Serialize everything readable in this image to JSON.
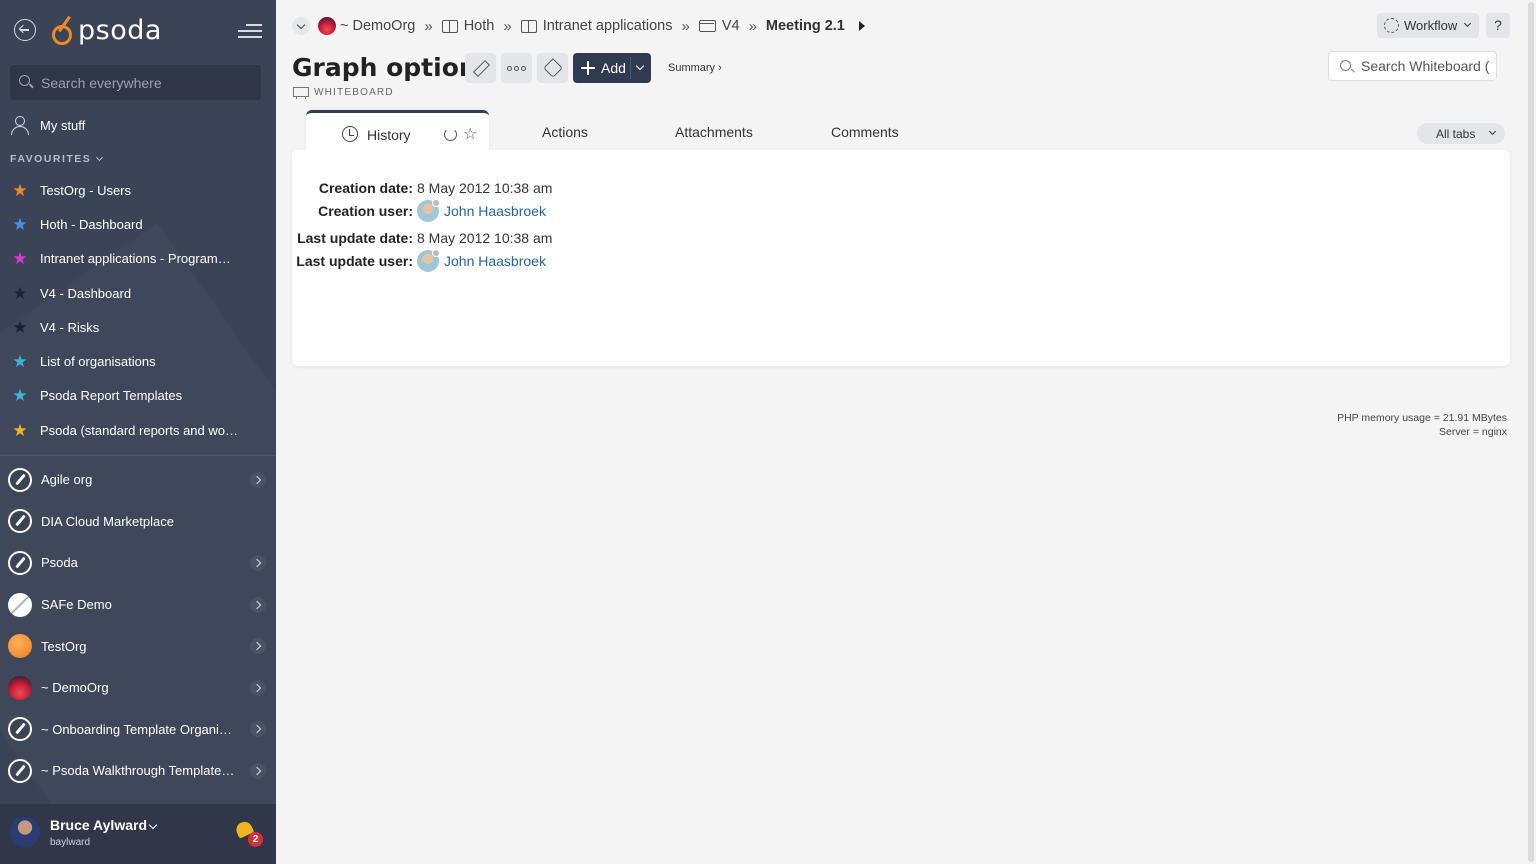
{
  "sidebar": {
    "logo_text": "psoda",
    "search_placeholder": "Search everywhere",
    "my_stuff": "My stuff",
    "favourites_heading": "FAVOURITES",
    "favourites": [
      {
        "label": "TestOrg - Users",
        "star_color": "#f08a24"
      },
      {
        "label": "Hoth - Dashboard",
        "star_color": "#4a90e2"
      },
      {
        "label": "Intranet applications - Programme...",
        "star_color": "#d43bd1"
      },
      {
        "label": "V4 - Dashboard",
        "star_color": "#1c2333"
      },
      {
        "label": "V4 - Risks",
        "star_color": "#1c2333"
      },
      {
        "label": "List of organisations",
        "star_color": "#3bb5d8"
      },
      {
        "label": "Psoda Report Templates",
        "star_color": "#3bb5d8"
      },
      {
        "label": "Psoda (standard reports and work...",
        "star_color": "#f2b51d"
      }
    ],
    "organisations": [
      {
        "label": "Agile org",
        "badge": "rocket",
        "has_arrow": true
      },
      {
        "label": "DIA Cloud Marketplace",
        "badge": "rocket",
        "has_arrow": false
      },
      {
        "label": "Psoda",
        "badge": "rocket",
        "has_arrow": true
      },
      {
        "label": "SAFe Demo",
        "badge": "safe",
        "has_arrow": true
      },
      {
        "label": "TestOrg",
        "badge": "testorg",
        "has_arrow": true
      },
      {
        "label": "~ DemoOrg",
        "badge": "demo",
        "has_arrow": true
      },
      {
        "label": "~ Onboarding Template Organisa...",
        "badge": "rocket",
        "has_arrow": true
      },
      {
        "label": "~ Psoda Walkthrough Template P...",
        "badge": "rocket",
        "has_arrow": true
      }
    ],
    "user": {
      "name": "Bruce Aylward",
      "login": "baylward",
      "notification_count": "2"
    }
  },
  "breadcrumb": [
    {
      "label": "~ DemoOrg",
      "icon": "org-logo"
    },
    {
      "label": "Hoth",
      "icon": "book-icon"
    },
    {
      "label": "Intranet applications",
      "icon": "book-icon"
    },
    {
      "label": "V4",
      "icon": "folder-icon"
    },
    {
      "label": "Meeting 2.1",
      "icon": ""
    }
  ],
  "breadcrumb_separator": "»",
  "header": {
    "workflow_label": "Workflow",
    "help_label": "?",
    "title": "Graph options",
    "object_type": "WHITEBOARD",
    "add_label": "Add",
    "summary_label": "Summary ›",
    "search_placeholder": "Search Whiteboard ("
  },
  "tabs": {
    "active": "History",
    "others": [
      "Actions",
      "Attachments",
      "Comments"
    ],
    "all_tabs_label": "All tabs"
  },
  "history": {
    "creation_date_label": "Creation date:",
    "creation_date": "8 May 2012 10:38 am",
    "creation_user_label": "Creation user:",
    "creation_user": "John Haasbroek",
    "last_update_date_label": "Last update date:",
    "last_update_date": "8 May 2012 10:38 am",
    "last_update_user_label": "Last update user:",
    "last_update_user": "John Haasbroek"
  },
  "footer": {
    "memory": "PHP memory usage = 21.91 MBytes",
    "server": "Server = nginx"
  },
  "colors": {
    "sidebar_bg": "#3b4357",
    "primary_button": "#303a50",
    "link": "#2563a8",
    "brand_orange": "#f08a24"
  }
}
